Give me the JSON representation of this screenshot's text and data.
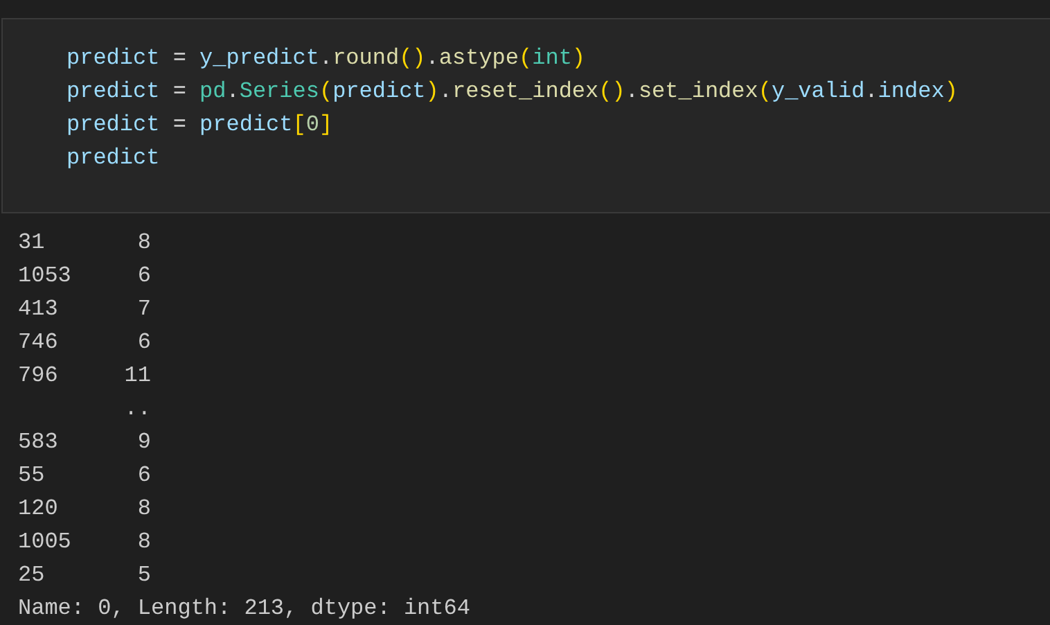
{
  "code_cell": {
    "lines": [
      [
        {
          "text": "predict",
          "kind": "var"
        },
        {
          "text": " = ",
          "kind": "op"
        },
        {
          "text": "y_predict",
          "kind": "var"
        },
        {
          "text": ".",
          "kind": "op"
        },
        {
          "text": "round",
          "kind": "func"
        },
        {
          "text": "()",
          "kind": "paren"
        },
        {
          "text": ".",
          "kind": "op"
        },
        {
          "text": "astype",
          "kind": "func"
        },
        {
          "text": "(",
          "kind": "paren"
        },
        {
          "text": "int",
          "kind": "class"
        },
        {
          "text": ")",
          "kind": "paren"
        }
      ],
      [
        {
          "text": "predict",
          "kind": "var"
        },
        {
          "text": " = ",
          "kind": "op"
        },
        {
          "text": "pd",
          "kind": "class"
        },
        {
          "text": ".",
          "kind": "op"
        },
        {
          "text": "Series",
          "kind": "class"
        },
        {
          "text": "(",
          "kind": "paren"
        },
        {
          "text": "predict",
          "kind": "var"
        },
        {
          "text": ")",
          "kind": "paren"
        },
        {
          "text": ".",
          "kind": "op"
        },
        {
          "text": "reset_index",
          "kind": "func"
        },
        {
          "text": "()",
          "kind": "paren"
        },
        {
          "text": ".",
          "kind": "op"
        },
        {
          "text": "set_index",
          "kind": "func"
        },
        {
          "text": "(",
          "kind": "paren"
        },
        {
          "text": "y_valid",
          "kind": "var"
        },
        {
          "text": ".",
          "kind": "op"
        },
        {
          "text": "index",
          "kind": "var"
        },
        {
          "text": ")",
          "kind": "paren"
        }
      ],
      [
        {
          "text": "predict",
          "kind": "var"
        },
        {
          "text": " = ",
          "kind": "op"
        },
        {
          "text": "predict",
          "kind": "var"
        },
        {
          "text": "[",
          "kind": "paren"
        },
        {
          "text": "0",
          "kind": "number"
        },
        {
          "text": "]",
          "kind": "paren"
        }
      ],
      [
        {
          "text": "predict",
          "kind": "var"
        }
      ]
    ]
  },
  "output": {
    "rows": [
      {
        "index": "31",
        "value": "8"
      },
      {
        "index": "1053",
        "value": "6"
      },
      {
        "index": "413",
        "value": "7"
      },
      {
        "index": "746",
        "value": "6"
      },
      {
        "index": "796",
        "value": "11"
      },
      {
        "value": ".."
      },
      {
        "index": "583",
        "value": "9"
      },
      {
        "index": "55",
        "value": "6"
      },
      {
        "index": "120",
        "value": "8"
      },
      {
        "index": "1005",
        "value": "8"
      },
      {
        "index": "25",
        "value": "5"
      }
    ],
    "footer": "Name: 0, Length: 213, dtype: int64"
  }
}
